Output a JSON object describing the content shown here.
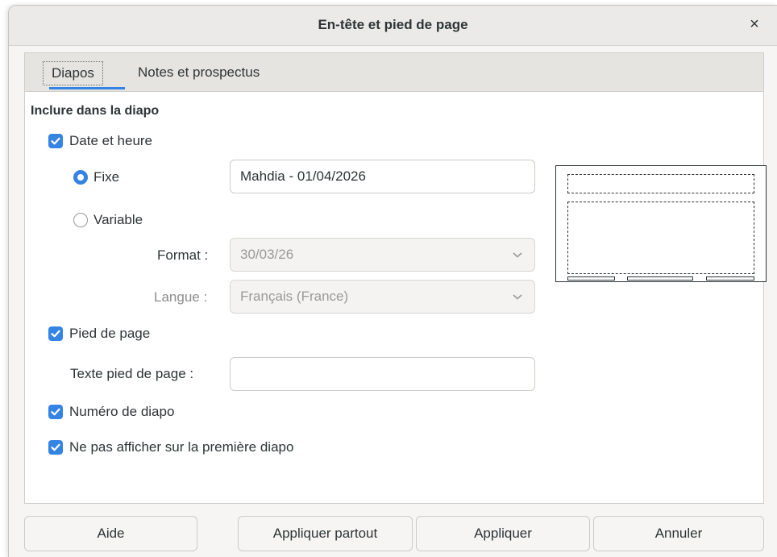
{
  "dialog": {
    "title": "En-tête et pied de page"
  },
  "tabs": [
    {
      "label": "Diapos",
      "active": true
    },
    {
      "label": "Notes et prospectus",
      "active": false
    }
  ],
  "section": {
    "title": "Inclure dans la diapo"
  },
  "date_time": {
    "label": "Date et heure",
    "checked": true,
    "fixed": {
      "label": "Fixe",
      "selected": true,
      "value": "Mahdia - 01/04/2026"
    },
    "variable": {
      "label": "Variable",
      "selected": false
    },
    "format": {
      "label": "Format :",
      "value": "30/03/26"
    },
    "language": {
      "label": "Langue :",
      "value": "Français (France)"
    }
  },
  "footer": {
    "label": "Pied de page",
    "checked": true,
    "text_label": "Texte pied de page :",
    "text_value": ""
  },
  "slide_number": {
    "label": "Numéro de diapo",
    "checked": true
  },
  "hide_first": {
    "label": "Ne pas afficher sur la première diapo",
    "checked": true
  },
  "buttons": {
    "help": "Aide",
    "apply_all": "Appliquer partout",
    "apply": "Appliquer",
    "cancel": "Annuler"
  },
  "colors": {
    "accent": "#3584e4",
    "border": "#cdcbc7",
    "bg": "#f6f5f4"
  },
  "icons": {
    "close": "close-icon",
    "check": "check-icon",
    "dropdown": "chevron-down-icon"
  }
}
